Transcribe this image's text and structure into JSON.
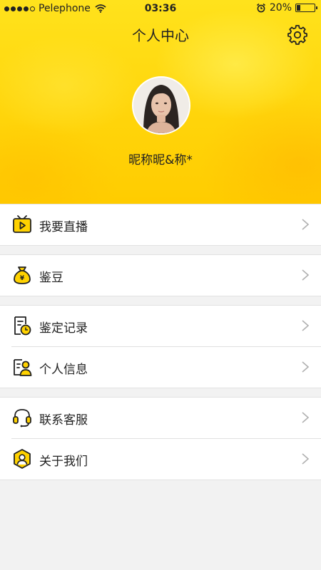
{
  "status_bar": {
    "carrier": "Pelephone",
    "time": "03:36",
    "battery_percent_text": "20%",
    "battery_level": 0.2,
    "signal_dots_filled": 4,
    "signal_dots_total": 5
  },
  "header": {
    "title": "个人中心",
    "nickname": "昵称昵&称*",
    "background_color": "#ffd40a"
  },
  "menu_groups": [
    {
      "items": [
        {
          "label": "我要直播",
          "icon": "tv-play-icon"
        }
      ]
    },
    {
      "items": [
        {
          "label": "鉴豆",
          "icon": "money-bag-icon"
        }
      ]
    },
    {
      "items": [
        {
          "label": "鉴定记录",
          "icon": "record-clock-icon"
        },
        {
          "label": "个人信息",
          "icon": "profile-card-icon"
        }
      ]
    },
    {
      "items": [
        {
          "label": "联系客服",
          "icon": "headset-icon"
        },
        {
          "label": "关于我们",
          "icon": "shield-user-icon"
        }
      ]
    }
  ],
  "colors": {
    "accent": "#ffd200",
    "icon_stroke": "#222222",
    "chevron": "#b0b0b0"
  }
}
